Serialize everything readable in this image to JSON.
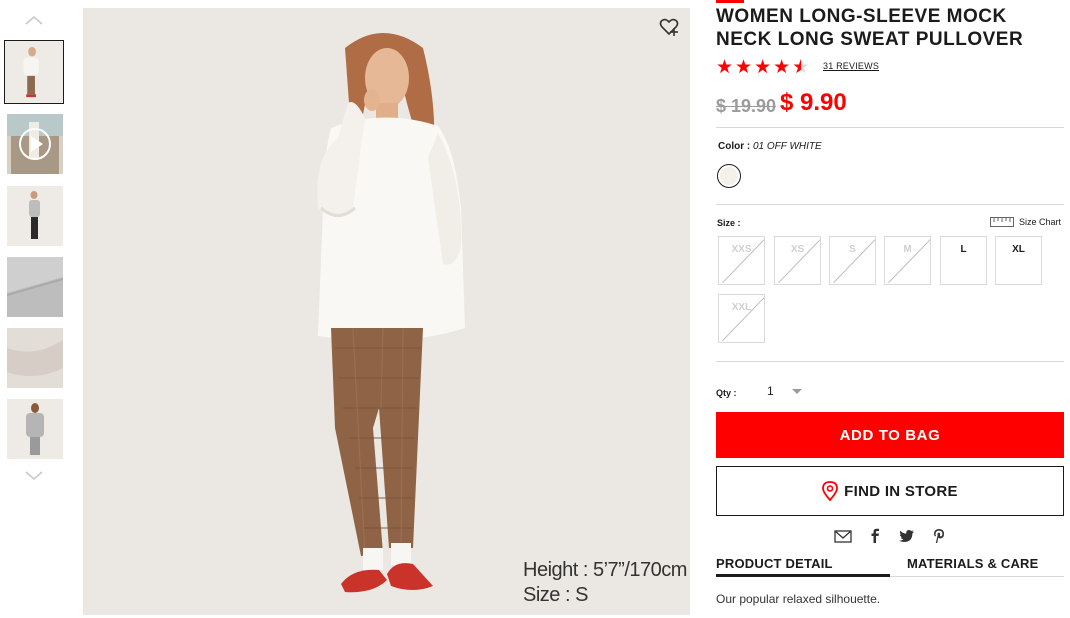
{
  "product": {
    "title": "WOMEN LONG-SLEEVE MOCK NECK LONG SWEAT PULLOVER",
    "rating": 4.5,
    "reviews_label": "31 REVIEWS",
    "old_price": "$ 19.90",
    "new_price": "$ 9.90",
    "color_label": "Color :",
    "color_value": "01 OFF WHITE",
    "size_label": "Size :",
    "size_chart_label": "Size Chart",
    "sizes": [
      {
        "label": "XXS",
        "available": false
      },
      {
        "label": "XS",
        "available": false
      },
      {
        "label": "S",
        "available": false
      },
      {
        "label": "M",
        "available": false
      },
      {
        "label": "L",
        "available": true
      },
      {
        "label": "XL",
        "available": true
      },
      {
        "label": "XXL",
        "available": false
      }
    ],
    "qty_label": "Qty :",
    "qty_value": "1",
    "add_to_bag": "ADD TO BAG",
    "find_in_store": "FIND IN STORE",
    "tabs": [
      "PRODUCT DETAIL",
      "MATERIALS & CARE"
    ],
    "description": "Our popular relaxed silhouette."
  },
  "image": {
    "caption_height": "Height : 5’7”/170cm",
    "caption_size": "Size : S"
  },
  "colors": {
    "accent": "#ff0000",
    "text": "#1b1b1b",
    "muted": "#9b9b9b"
  },
  "icons": [
    "chevron-up-icon",
    "chevron-down-icon",
    "play-icon",
    "heart-plus-icon",
    "ruler-icon",
    "location-pin-icon",
    "mail-icon",
    "facebook-icon",
    "twitter-icon",
    "pinterest-icon"
  ]
}
